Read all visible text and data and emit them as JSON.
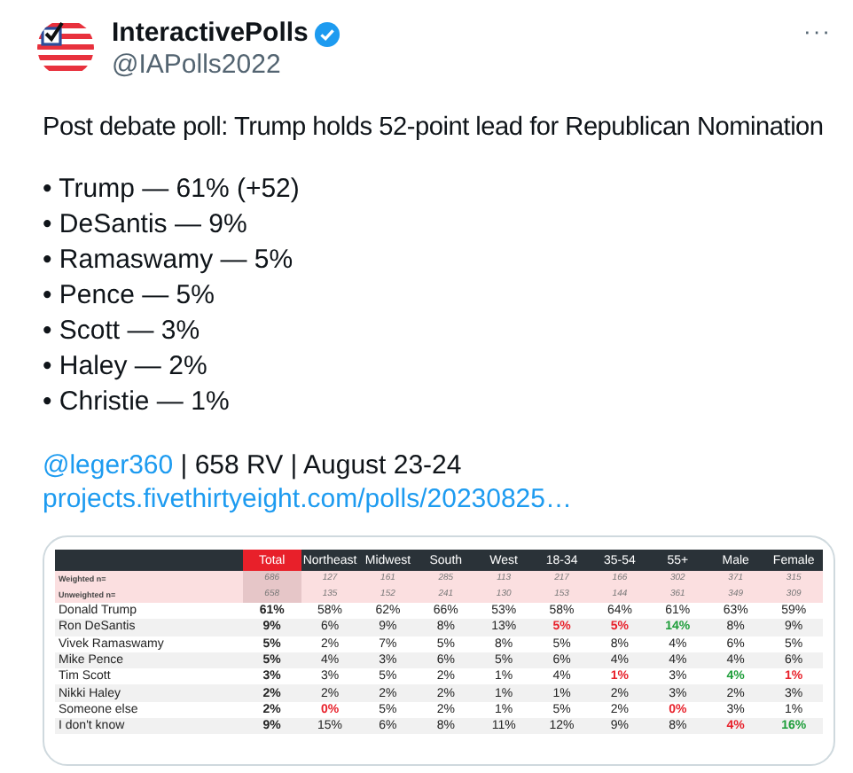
{
  "author": {
    "name": "InteractivePolls",
    "verified": true,
    "handle": "@IAPolls2022",
    "more": "···"
  },
  "headline": "Post debate poll: Trump holds 52-point lead for Republican Nomination",
  "bullets": [
    "• Trump — 61% (+52)",
    "• DeSantis — 9%",
    "• Ramaswamy — 5%",
    "• Pence — 5%",
    "• Scott — 3%",
    "• Haley — 2%",
    "• Christie — 1%"
  ],
  "source": {
    "mention": "@leger360",
    "details": " | 658 RV | August 23-24",
    "link": "projects.fivethirtyeight.com/polls/20230825…"
  },
  "table": {
    "columns": [
      "Total",
      "Northeast",
      "Midwest",
      "South",
      "West",
      "18-34",
      "35-54",
      "55+",
      "Male",
      "Female"
    ],
    "sample_rows": [
      {
        "label": "Weighted n=",
        "values": [
          "686",
          "127",
          "161",
          "285",
          "113",
          "217",
          "166",
          "302",
          "371",
          "315"
        ]
      },
      {
        "label": "Unweighted n=",
        "values": [
          "658",
          "135",
          "152",
          "241",
          "130",
          "153",
          "144",
          "361",
          "349",
          "309"
        ]
      }
    ],
    "rows": [
      {
        "label": "Donald Trump",
        "cells": [
          {
            "text": "61%"
          },
          {
            "text": "58%"
          },
          {
            "text": "62%"
          },
          {
            "text": "66%"
          },
          {
            "text": "53%"
          },
          {
            "text": "58%"
          },
          {
            "text": "64%"
          },
          {
            "text": "61%"
          },
          {
            "text": "63%"
          },
          {
            "text": "59%"
          }
        ]
      },
      {
        "label": "Ron DeSantis",
        "cells": [
          {
            "text": "9%"
          },
          {
            "text": "6%"
          },
          {
            "text": "9%"
          },
          {
            "text": "8%"
          },
          {
            "text": "13%"
          },
          {
            "text": "5%",
            "color": "#e8202a"
          },
          {
            "text": "5%",
            "color": "#e8202a"
          },
          {
            "text": "14%",
            "color": "#1e9e3a"
          },
          {
            "text": "8%"
          },
          {
            "text": "9%"
          }
        ]
      },
      {
        "label": "Vivek Ramaswamy",
        "cells": [
          {
            "text": "5%"
          },
          {
            "text": "2%"
          },
          {
            "text": "7%"
          },
          {
            "text": "5%"
          },
          {
            "text": "8%"
          },
          {
            "text": "5%"
          },
          {
            "text": "8%"
          },
          {
            "text": "4%"
          },
          {
            "text": "6%"
          },
          {
            "text": "5%"
          }
        ]
      },
      {
        "label": "Mike Pence",
        "cells": [
          {
            "text": "5%"
          },
          {
            "text": "4%"
          },
          {
            "text": "3%"
          },
          {
            "text": "6%"
          },
          {
            "text": "5%"
          },
          {
            "text": "6%"
          },
          {
            "text": "4%"
          },
          {
            "text": "4%"
          },
          {
            "text": "4%"
          },
          {
            "text": "6%"
          }
        ]
      },
      {
        "label": "Tim Scott",
        "cells": [
          {
            "text": "3%"
          },
          {
            "text": "3%"
          },
          {
            "text": "5%"
          },
          {
            "text": "2%"
          },
          {
            "text": "1%"
          },
          {
            "text": "4%"
          },
          {
            "text": "1%",
            "color": "#e8202a"
          },
          {
            "text": "3%"
          },
          {
            "text": "4%",
            "color": "#1e9e3a"
          },
          {
            "text": "1%",
            "color": "#e8202a"
          }
        ]
      },
      {
        "label": "Nikki Haley",
        "cells": [
          {
            "text": "2%"
          },
          {
            "text": "2%"
          },
          {
            "text": "2%"
          },
          {
            "text": "2%"
          },
          {
            "text": "1%"
          },
          {
            "text": "1%"
          },
          {
            "text": "2%"
          },
          {
            "text": "3%"
          },
          {
            "text": "2%"
          },
          {
            "text": "3%"
          }
        ]
      },
      {
        "label": "Someone else",
        "cells": [
          {
            "text": "2%"
          },
          {
            "text": "0%",
            "color": "#e8202a"
          },
          {
            "text": "5%"
          },
          {
            "text": "2%"
          },
          {
            "text": "1%"
          },
          {
            "text": "5%"
          },
          {
            "text": "2%"
          },
          {
            "text": "0%",
            "color": "#e8202a"
          },
          {
            "text": "3%"
          },
          {
            "text": "1%"
          }
        ]
      },
      {
        "label": "I don't know",
        "cells": [
          {
            "text": "9%"
          },
          {
            "text": "15%"
          },
          {
            "text": "6%"
          },
          {
            "text": "8%"
          },
          {
            "text": "11%"
          },
          {
            "text": "12%"
          },
          {
            "text": "9%"
          },
          {
            "text": "8%"
          },
          {
            "text": "4%",
            "color": "#e8202a"
          },
          {
            "text": "16%",
            "color": "#1e9e3a"
          }
        ]
      }
    ]
  }
}
